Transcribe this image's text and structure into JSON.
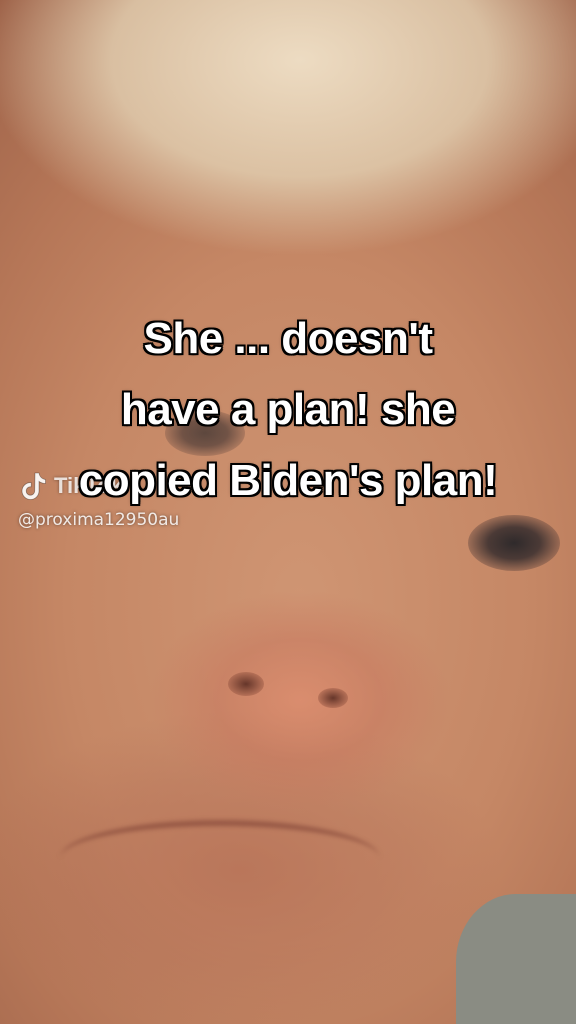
{
  "video": {
    "caption_lines": [
      "She ... doesn't",
      "have a plan! she",
      "copied Biden's plan!"
    ]
  },
  "watermark": {
    "brand": "TikTok",
    "handle": "@proxima12950au",
    "icon": "tiktok-logo-icon"
  },
  "colors": {
    "caption_text": "#ffffff",
    "caption_outline": "#000000"
  }
}
